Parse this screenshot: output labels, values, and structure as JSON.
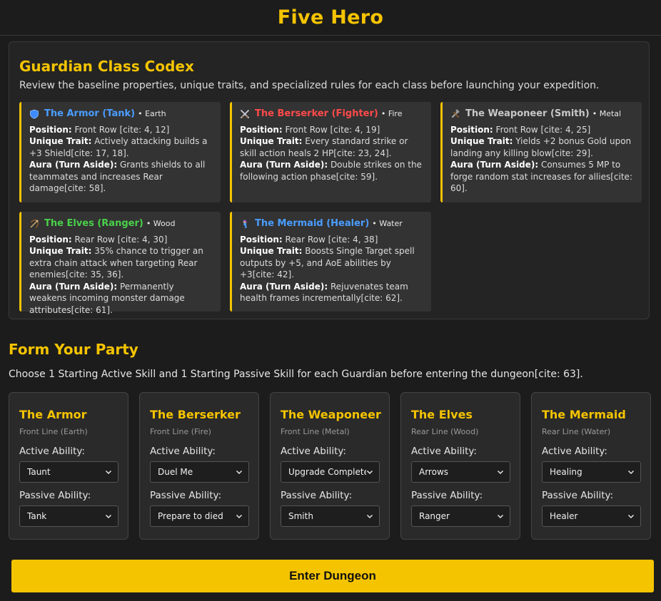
{
  "app": {
    "title": "Five Hero"
  },
  "codex": {
    "title": "Guardian Class Codex",
    "description": "Review the baseline properties, unique traits, and specialized rules for each class before launching your expedition.",
    "labels": {
      "position": "Position:",
      "trait": "Unique Trait:",
      "aura": "Aura (Turn Aside):"
    },
    "classes": [
      {
        "icon": "shield-icon",
        "name": "The Armor (Tank)",
        "element": " • Earth",
        "name_color": "#4a9dff",
        "position": " Front Row [cite: 4, 12]",
        "trait": " Actively attacking builds a +3 Shield[cite: 17, 18].",
        "aura": " Grants shields to all teammates and increases Rear damage[cite: 58]."
      },
      {
        "icon": "crossed-swords-icon",
        "name": "The Berserker (Fighter)",
        "element": " • Fire",
        "name_color": "#ff4a4a",
        "position": " Front Row [cite: 4, 19]",
        "trait": " Every standard strike or skill action heals 2 HP[cite: 23, 24].",
        "aura": " Double strikes on the following action phase[cite: 59]."
      },
      {
        "icon": "hammer-wrench-icon",
        "name": "The Weaponeer (Smith)",
        "element": " • Metal",
        "name_color": "#c8c8c8",
        "position": " Front Row [cite: 4, 25]",
        "trait": " Yields +2 bonus Gold upon landing any killing blow[cite: 29].",
        "aura": " Consumes 5 MP to forge random stat increases for allies[cite: 60]."
      },
      {
        "icon": "bow-arrow-icon",
        "name": "The Elves (Ranger)",
        "element": " • Wood",
        "name_color": "#4ad04a",
        "position": " Rear Row [cite: 4, 30]",
        "trait": " 35% chance to trigger an extra chain attack when targeting Rear enemies[cite: 35, 36].",
        "aura": " Permanently weakens incoming monster damage attributes[cite: 61]."
      },
      {
        "icon": "mermaid-icon",
        "name": "The Mermaid (Healer)",
        "element": " • Water",
        "name_color": "#4a9dff",
        "position": " Rear Row [cite: 4, 38]",
        "trait": " Boosts Single Target spell outputs by +5, and AoE abilities by +3[cite: 42].",
        "aura": " Rejuvenates team health frames incrementally[cite: 62]."
      }
    ]
  },
  "party": {
    "title": "Form Your Party",
    "description": "Choose 1 Starting Active Skill and 1 Starting Passive Skill for each Guardian before entering the dungeon[cite: 63].",
    "active_label": "Active Ability:",
    "passive_label": "Passive Ability:",
    "members": [
      {
        "name": "The Armor",
        "line": "Front Line (Earth)",
        "active": "Taunt",
        "passive": "Tank"
      },
      {
        "name": "The Berserker",
        "line": "Front Line (Fire)",
        "active": "Duel Me",
        "passive": "Prepare to died"
      },
      {
        "name": "The Weaponeer",
        "line": "Front Line (Metal)",
        "active": "Upgrade Complete",
        "passive": "Smith"
      },
      {
        "name": "The Elves",
        "line": "Rear Line (Wood)",
        "active": "Arrows",
        "passive": "Ranger"
      },
      {
        "name": "The Mermaid",
        "line": "Rear Line (Water)",
        "active": "Healing",
        "passive": "Healer"
      }
    ]
  },
  "actions": {
    "enter_label": "Enter Dungeon"
  },
  "colors": {
    "accent": "#f5c400",
    "background": "#1c1c1c"
  }
}
